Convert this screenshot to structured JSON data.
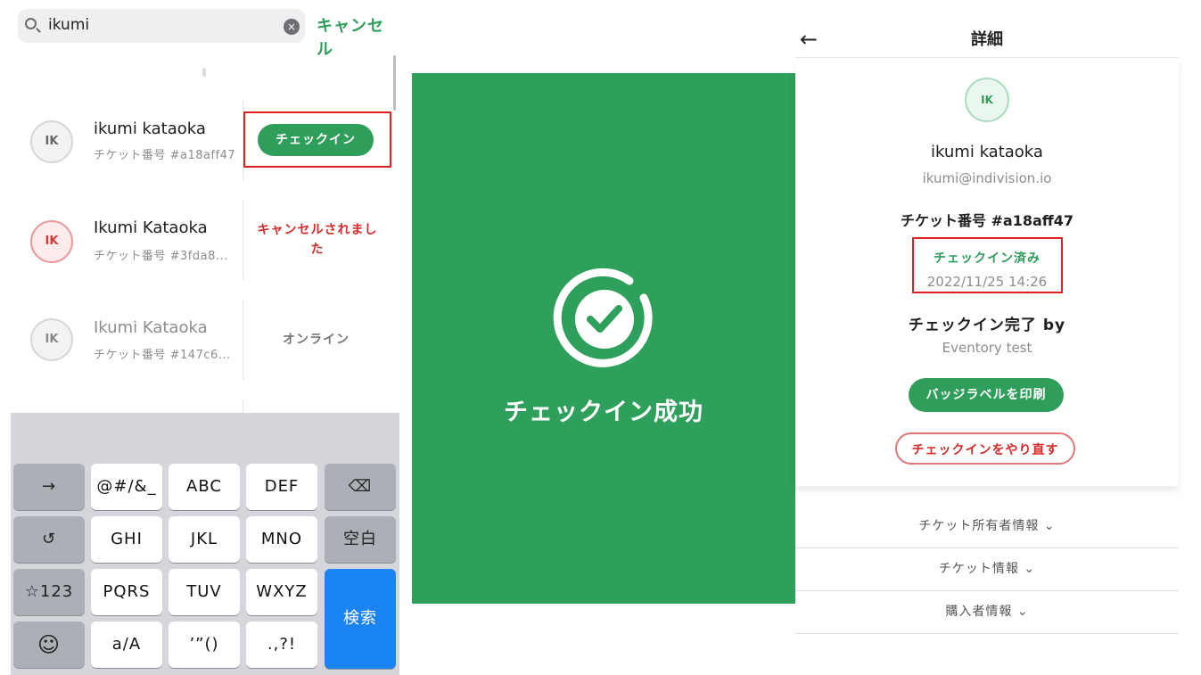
{
  "search": {
    "query": "ikumi",
    "clear_icon": "×",
    "cancel_label": "キャンセル"
  },
  "attendees": [
    {
      "initials": "IK",
      "name": "ikumi kataoka",
      "ticket": "チケット番号 #a18aff47",
      "action": "チェックイン"
    },
    {
      "initials": "IK",
      "name": "Ikumi Kataoka",
      "ticket": "チケット番号 #3fda8...",
      "status_line1": "キャンセルされまし",
      "status_line2": "た"
    },
    {
      "initials": "IK",
      "name": "Ikumi Kataoka",
      "ticket": "チケット番号 #147c6...",
      "status": "オンライン"
    }
  ],
  "keyboard": {
    "keys": {
      "arrow": "→",
      "symbols": "@#/&_",
      "abc": "ABC",
      "def": "DEF",
      "delete": "⌫",
      "undo": "↺",
      "ghi": "GHI",
      "jkl": "JKL",
      "mno": "MNO",
      "space": "空白",
      "num": "☆123",
      "pqrs": "PQRS",
      "tuv": "TUV",
      "wxyz": "WXYZ",
      "search": "検索",
      "emoji": "☺",
      "case": "a/A",
      "quote": "’”()",
      "punct": ".,?!"
    }
  },
  "success": {
    "message": "チェックイン成功"
  },
  "detail": {
    "back_icon": "←",
    "title": "詳細",
    "initials": "IK",
    "name": "ikumi kataoka",
    "email": "ikumi@indivision.io",
    "ticket": "チケット番号 #a18aff47",
    "status": "チェックイン済み",
    "checked_in_at": "2022/11/25 14:26",
    "completed_by_label": "チェックイン完了 by",
    "completed_by": "Eventory test",
    "print_label": "バッジラベルを印刷",
    "redo_label": "チェックインをやり直す",
    "sections": [
      "チケット所有者情報 ⌄",
      "チケット情報 ⌄",
      "購入者情報 ⌄"
    ]
  },
  "colors": {
    "brand_green": "#2e9e5a",
    "success_bg": "#2ea05b",
    "error_red": "#d42b2b",
    "highlight_frame": "#e02020",
    "keyboard_blue": "#1b84f5"
  }
}
